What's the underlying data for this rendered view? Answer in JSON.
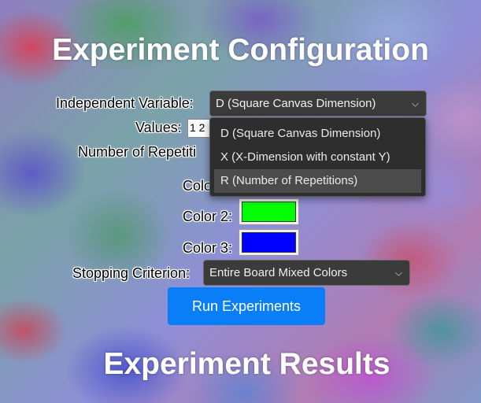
{
  "titles": {
    "config": "Experiment Configuration",
    "results": "Experiment Results"
  },
  "form": {
    "independent_variable_label": "Independent Variable:",
    "independent_variable_value": "D (Square Canvas Dimension)",
    "independent_variable_options": [
      {
        "label": "D (Square Canvas Dimension)",
        "highlighted": false
      },
      {
        "label": "X (X-Dimension with constant Y)",
        "highlighted": false
      },
      {
        "label": "R (Number of Repetitions)",
        "highlighted": true
      }
    ],
    "values_label": "Values:",
    "values_value": "1 2",
    "repetitions_label": "Number of Repetiti",
    "color1_label": "Colo",
    "color2_label": "Color 2:",
    "color2_value": "#00ff00",
    "color3_label": "Color 3:",
    "color3_value": "#0000ff",
    "stopping_label": "Stopping Criterion:",
    "stopping_value": "Entire Board Mixed Colors",
    "run_button": "Run Experiments"
  },
  "colors": {
    "button": "#0a7ef7",
    "dropdown_bg": "#3b3b3b",
    "menu_bg": "#2e2e2e"
  },
  "icons": {
    "dropdown": "chevron-down-icon"
  }
}
